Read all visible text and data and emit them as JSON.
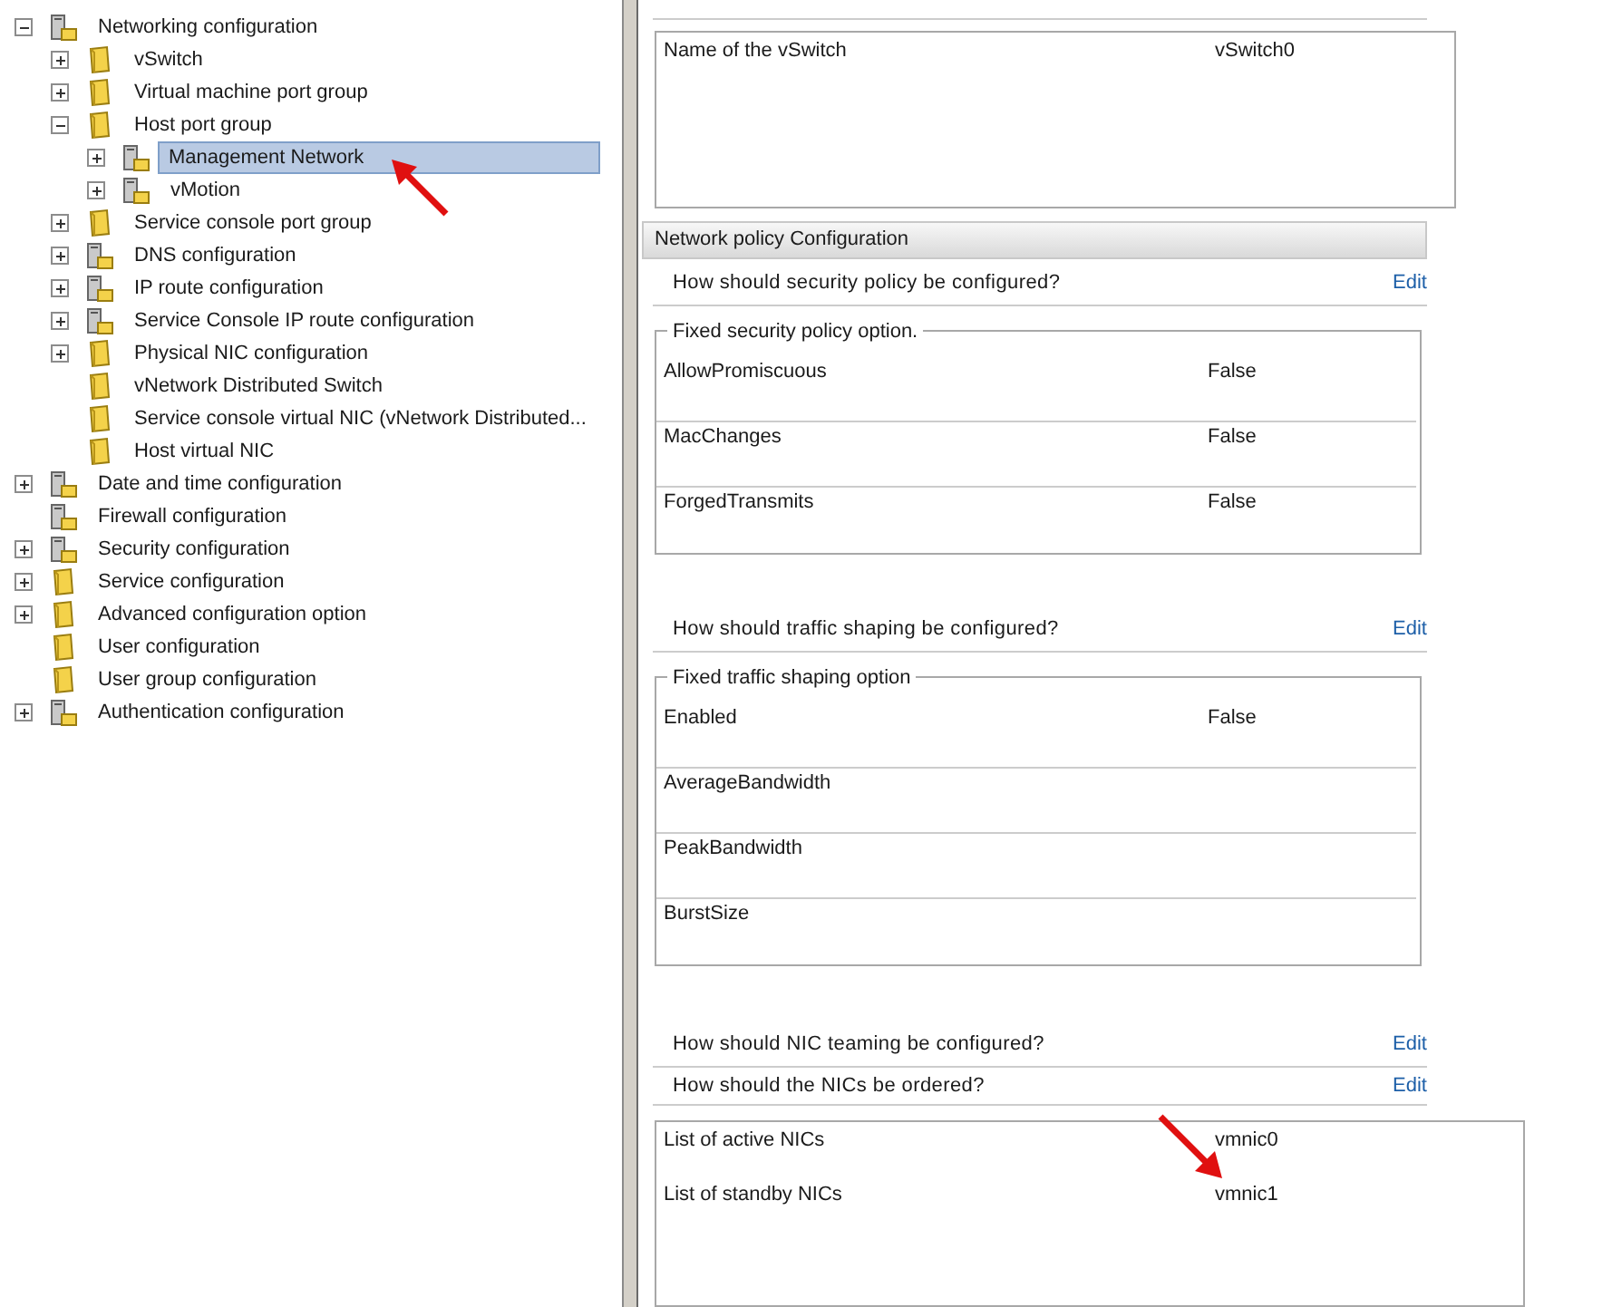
{
  "tree": [
    {
      "label": "Networking configuration",
      "kind": "server",
      "expandable": true,
      "expanded": true,
      "selected": false,
      "children": [
        {
          "label": "vSwitch",
          "kind": "folder",
          "expandable": true,
          "expanded": false,
          "selected": false
        },
        {
          "label": "Virtual machine port group",
          "kind": "folder",
          "expandable": true,
          "expanded": false,
          "selected": false
        },
        {
          "label": "Host port group",
          "kind": "folder",
          "expandable": true,
          "expanded": true,
          "selected": false,
          "children": [
            {
              "label": "Management Network",
              "kind": "server",
              "expandable": true,
              "expanded": false,
              "selected": true
            },
            {
              "label": "vMotion",
              "kind": "server",
              "expandable": true,
              "expanded": false,
              "selected": false
            }
          ]
        },
        {
          "label": "Service console port group",
          "kind": "folder",
          "expandable": true,
          "expanded": false,
          "selected": false
        },
        {
          "label": "DNS configuration",
          "kind": "server",
          "expandable": true,
          "expanded": false,
          "selected": false
        },
        {
          "label": "IP route configuration",
          "kind": "server",
          "expandable": true,
          "expanded": false,
          "selected": false
        },
        {
          "label": "Service Console IP route configuration",
          "kind": "server",
          "expandable": true,
          "expanded": false,
          "selected": false
        },
        {
          "label": "Physical NIC configuration",
          "kind": "folder",
          "expandable": true,
          "expanded": false,
          "selected": false
        },
        {
          "label": "vNetwork Distributed Switch",
          "kind": "folder",
          "expandable": false,
          "selected": false
        },
        {
          "label": "Service console virtual NIC (vNetwork Distributed...",
          "kind": "folder",
          "expandable": false,
          "selected": false
        },
        {
          "label": "Host virtual NIC",
          "kind": "folder",
          "expandable": false,
          "selected": false
        }
      ]
    },
    {
      "label": "Date and time configuration",
      "kind": "server",
      "expandable": true,
      "expanded": false,
      "selected": false
    },
    {
      "label": "Firewall configuration",
      "kind": "server",
      "expandable": false,
      "selected": false
    },
    {
      "label": "Security configuration",
      "kind": "server",
      "expandable": true,
      "expanded": false,
      "selected": false
    },
    {
      "label": "Service configuration",
      "kind": "folder",
      "expandable": true,
      "expanded": false,
      "selected": false
    },
    {
      "label": "Advanced configuration option",
      "kind": "folder",
      "expandable": true,
      "expanded": false,
      "selected": false
    },
    {
      "label": "User configuration",
      "kind": "folder",
      "expandable": false,
      "selected": false
    },
    {
      "label": "User group configuration",
      "kind": "folder",
      "expandable": false,
      "selected": false
    },
    {
      "label": "Authentication configuration",
      "kind": "server",
      "expandable": true,
      "expanded": false,
      "selected": false
    }
  ],
  "vswitch": {
    "rows": [
      {
        "label": "Name of the vSwitch",
        "value": "vSwitch0"
      }
    ]
  },
  "policy": {
    "title": "Network policy Configuration",
    "sections": [
      {
        "question": "How should security policy be configured?",
        "link": "Edit",
        "options": {
          "legend": "Fixed security policy option.",
          "rows": [
            {
              "label": "AllowPromiscuous",
              "value": "False"
            },
            {
              "label": "MacChanges",
              "value": "False"
            },
            {
              "label": "ForgedTransmits",
              "value": "False"
            }
          ]
        }
      },
      {
        "question": "How should traffic shaping be configured?",
        "link": "Edit",
        "options": {
          "legend": "Fixed traffic shaping option",
          "rows": [
            {
              "label": "Enabled",
              "value": "False"
            },
            {
              "label": "AverageBandwidth"
            },
            {
              "label": "PeakBandwidth"
            },
            {
              "label": "BurstSize"
            }
          ]
        }
      }
    ]
  },
  "teaming": {
    "questions": [
      {
        "question": "How should NIC teaming be configured?",
        "link": "Edit"
      },
      {
        "question": "How should the NICs be ordered?",
        "link": "Edit"
      }
    ],
    "nics": {
      "rows": [
        {
          "label": "List of active NICs",
          "value": "vmnic0"
        },
        {
          "label": "List of standby NICs",
          "value": "vmnic1"
        }
      ]
    }
  }
}
